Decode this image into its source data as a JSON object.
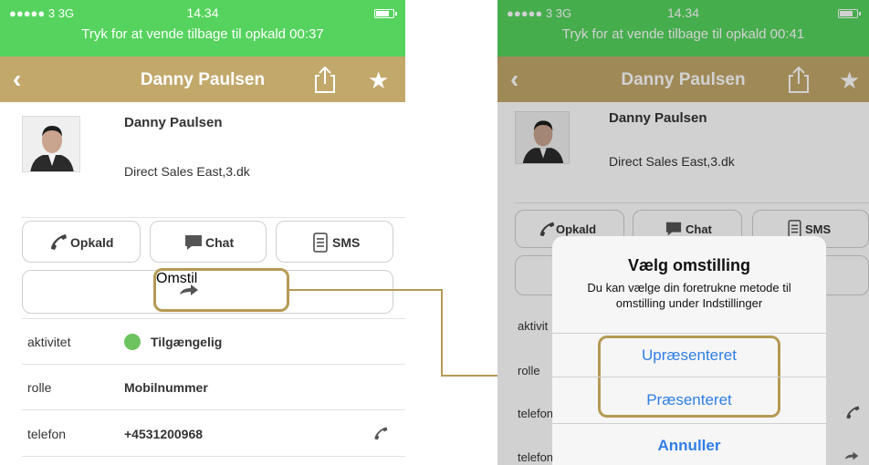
{
  "left": {
    "status": {
      "signal": "●●●●● 3   3G",
      "time": "14.34",
      "callback": "Tryk for at vende tilbage til opkald 00:37"
    },
    "nav": {
      "title": "Danny Paulsen"
    },
    "contact": {
      "name": "Danny Paulsen",
      "department": "Direct Sales East,3.dk"
    },
    "actions": {
      "call": "Opkald",
      "chat": "Chat",
      "sms": "SMS",
      "transfer": "Omstil"
    },
    "details": [
      {
        "label": "aktivitet",
        "value": "Tilgængelig"
      },
      {
        "label": "rolle",
        "value": "Mobilnummer"
      },
      {
        "label": "telefon",
        "value": "+4531200968"
      }
    ]
  },
  "right": {
    "status": {
      "signal": "●●●●● 3   3G",
      "time": "14.34",
      "callback": "Tryk for at vende tilbage til opkald 00:41"
    },
    "nav": {
      "title": "Danny Paulsen"
    },
    "contact": {
      "name": "Danny Paulsen",
      "department": "Direct Sales East,3.dk"
    },
    "actions": {
      "call": "Opkald",
      "chat": "Chat",
      "sms": "SMS"
    },
    "details": [
      {
        "label": "aktivit"
      },
      {
        "label": "rolle"
      },
      {
        "label": "telefon"
      },
      {
        "label": "telefon"
      }
    ],
    "dialog": {
      "title": "Vælg omstilling",
      "message": "Du kan vælge din foretrukne metode til omstilling under Indstillinger",
      "options": [
        "Upræsenteret",
        "Præsenteret"
      ],
      "cancel": "Annuller"
    }
  },
  "colors": {
    "status_green": "#56d35e",
    "nav_gold": "#c2a86b",
    "highlight_gold": "#b59a54",
    "ios_blue": "#2f7ee6",
    "available_green": "#6dc35f"
  },
  "icons": [
    "chevron-left-icon",
    "share-icon",
    "star-icon",
    "phone-icon",
    "chat-bubble-icon",
    "sms-icon",
    "transfer-arrow-icon",
    "status-dot-icon"
  ]
}
